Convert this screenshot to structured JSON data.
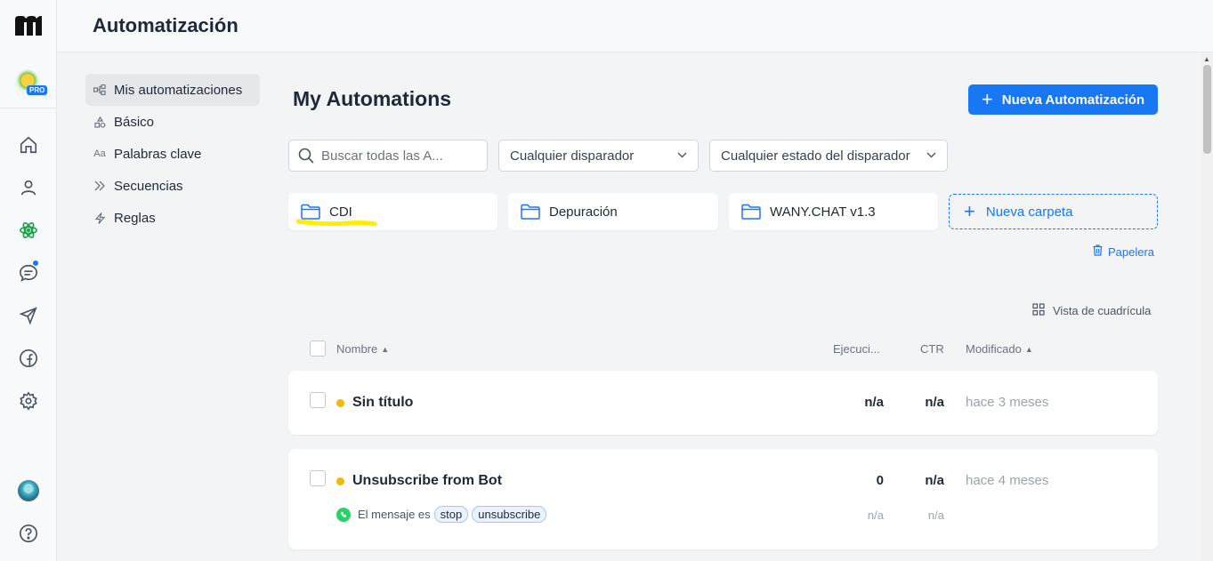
{
  "header": {
    "title": "Automatización"
  },
  "rail": {
    "pro_label": "PRO",
    "icons": [
      "home-icon",
      "user-icon",
      "automation-icon",
      "chat-icon",
      "send-icon",
      "facebook-icon",
      "settings-icon",
      "help-icon"
    ]
  },
  "subnav": {
    "items": [
      {
        "label": "Mis automatizaciones",
        "icon": "flow-icon",
        "active": true
      },
      {
        "label": "Básico",
        "icon": "shapes-icon"
      },
      {
        "label": "Palabras clave",
        "icon": "keyword-icon",
        "glyph": "Aa"
      },
      {
        "label": "Secuencias",
        "icon": "sequence-icon"
      },
      {
        "label": "Reglas",
        "icon": "bolt-icon"
      }
    ]
  },
  "main": {
    "title": "My Automations",
    "new_button": "Nueva Automatización",
    "search": {
      "placeholder": "Buscar todas las A..."
    },
    "filter_trigger": "Cualquier disparador",
    "filter_status": "Cualquier estado del disparador",
    "folders": [
      {
        "name": "CDI"
      },
      {
        "name": "Depuración"
      },
      {
        "name": "WANY.CHAT v1.3"
      }
    ],
    "new_folder": "Nueva carpeta",
    "trash": "Papelera",
    "grid_view": "Vista de cuadrícula",
    "colors": {
      "accent": "#1877f2",
      "status_draft": "#f5b800",
      "highlight": "#ffee00"
    }
  },
  "table": {
    "headers": {
      "name": "Nombre",
      "runs": "Ejecuci...",
      "ctr": "CTR",
      "modified": "Modificado"
    },
    "rows": [
      {
        "name": "Sin título",
        "runs": "n/a",
        "ctr": "n/a",
        "modified": "hace 3 meses"
      },
      {
        "name": "Unsubscribe from Bot",
        "runs": "0",
        "ctr": "n/a",
        "modified": "hace 4 meses",
        "trigger": {
          "label": "El mensaje es",
          "keywords": [
            "stop",
            "unsubscribe"
          ],
          "runs": "n/a",
          "ctr": "n/a"
        }
      }
    ]
  }
}
